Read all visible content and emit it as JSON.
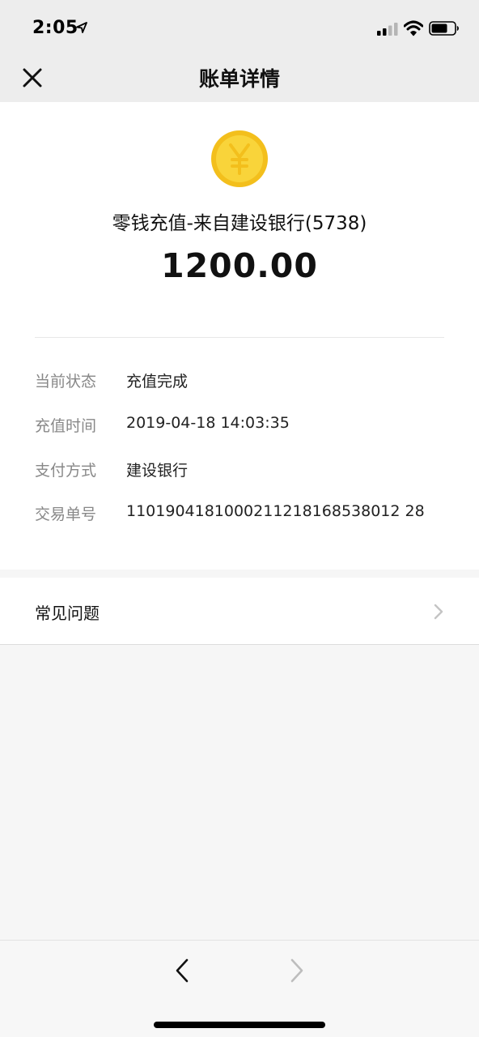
{
  "status_bar": {
    "time": "2:05",
    "icons": [
      "location-arrow-icon",
      "cellular-signal-icon",
      "wifi-icon",
      "battery-icon"
    ]
  },
  "nav": {
    "title": "账单详情",
    "close_icon": "close-icon"
  },
  "transaction": {
    "icon": "yuan-coin-icon",
    "title": "零钱充值-来自建设银行(5738)",
    "amount": "1200.00",
    "details": [
      {
        "label": "当前状态",
        "value": "充值完成"
      },
      {
        "label": "充值时间",
        "value": "2019-04-18 14:03:35"
      },
      {
        "label": "支付方式",
        "value": "建设银行"
      },
      {
        "label": "交易单号",
        "value": "1101904181000211218168538012 28"
      }
    ]
  },
  "faq": {
    "label": "常见问题",
    "icon": "chevron-right-icon"
  },
  "bottom_nav": {
    "back_icon": "chevron-left-icon",
    "forward_icon": "chevron-right-icon"
  },
  "colors": {
    "nav_background": "#ededed",
    "page_background": "#f6f6f6",
    "coin_yellow": "#f9d43a",
    "coin_border": "#f3bf1c",
    "label_gray": "#888888"
  }
}
